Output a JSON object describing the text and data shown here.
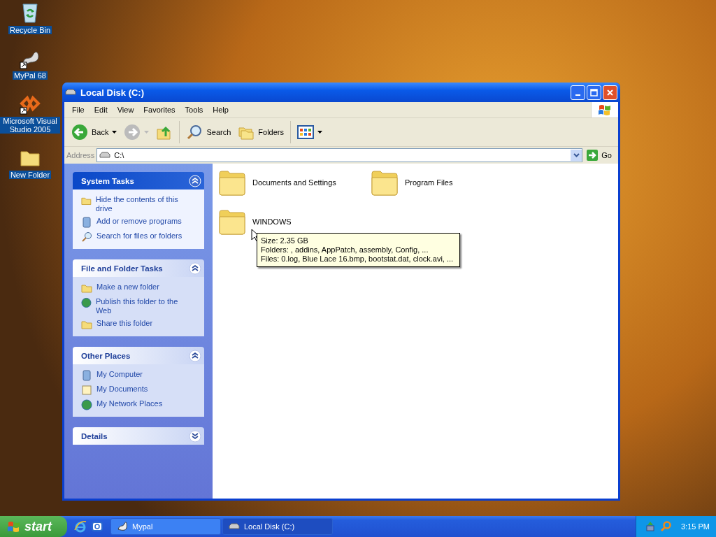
{
  "desktop_icons": [
    {
      "kind": "recycle",
      "label": "Recycle Bin"
    },
    {
      "kind": "app",
      "label": "MyPal 68"
    },
    {
      "kind": "studio",
      "label": "Microsoft Visual Studio 2005"
    },
    {
      "kind": "folder",
      "label": "New Folder"
    }
  ],
  "window": {
    "title": "Local Disk (C:)",
    "menu": [
      "File",
      "Edit",
      "View",
      "Favorites",
      "Tools",
      "Help"
    ],
    "toolbar": [
      {
        "kind": "back",
        "label": "Back",
        "disabled": false
      },
      {
        "kind": "forward",
        "disabled": true
      },
      {
        "kind": "up",
        "disabled": false
      },
      {
        "kind": "search",
        "label": "Search",
        "disabled": false
      },
      {
        "kind": "folders",
        "label": "Folders",
        "disabled": false
      },
      {
        "kind": "views",
        "disabled": false
      }
    ],
    "address": {
      "label": "Address",
      "value": "C:\\",
      "go": "Go"
    },
    "task_panels": [
      {
        "kind": "special",
        "title": "System Tasks",
        "expanded": true,
        "items": [
          {
            "kind": "hide",
            "label": "Hide the contents of this drive"
          },
          {
            "kind": "programs",
            "label": "Add or remove programs"
          },
          {
            "kind": "search",
            "label": "Search for files or folders"
          }
        ]
      },
      {
        "kind": "normal",
        "title": "File and Folder Tasks",
        "expanded": true,
        "items": [
          {
            "kind": "newfolder",
            "label": "Make a new folder"
          },
          {
            "kind": "publish",
            "label": "Publish this folder to the Web"
          },
          {
            "kind": "share",
            "label": "Share this folder"
          }
        ]
      },
      {
        "kind": "normal",
        "title": "Other Places",
        "expanded": true,
        "items": [
          {
            "kind": "computer",
            "label": "My Computer"
          },
          {
            "kind": "documents",
            "label": "My Documents"
          },
          {
            "kind": "network",
            "label": "My Network Places"
          }
        ]
      },
      {
        "kind": "normal",
        "title": "Details",
        "expanded": false
      }
    ],
    "folders": [
      {
        "name": "Documents and Settings"
      },
      {
        "name": "Program Files"
      },
      {
        "name": "WINDOWS"
      }
    ],
    "tooltip": [
      "Size: 2.35 GB",
      "Folders: , addins, AppPatch, assembly, Config, ...",
      "Files: 0.log, Blue Lace 16.bmp, bootstat.dat, clock.avi, ..."
    ]
  },
  "taskbar": {
    "start": "start",
    "quick_launch": [
      {
        "kind": "browser"
      },
      {
        "kind": "mail"
      }
    ],
    "tasks": [
      {
        "kind": "app",
        "label": "Mypal",
        "selected": false
      },
      {
        "kind": "drive",
        "label": "Local Disk (C:)",
        "selected": true
      }
    ],
    "clock": "3:15 PM"
  }
}
